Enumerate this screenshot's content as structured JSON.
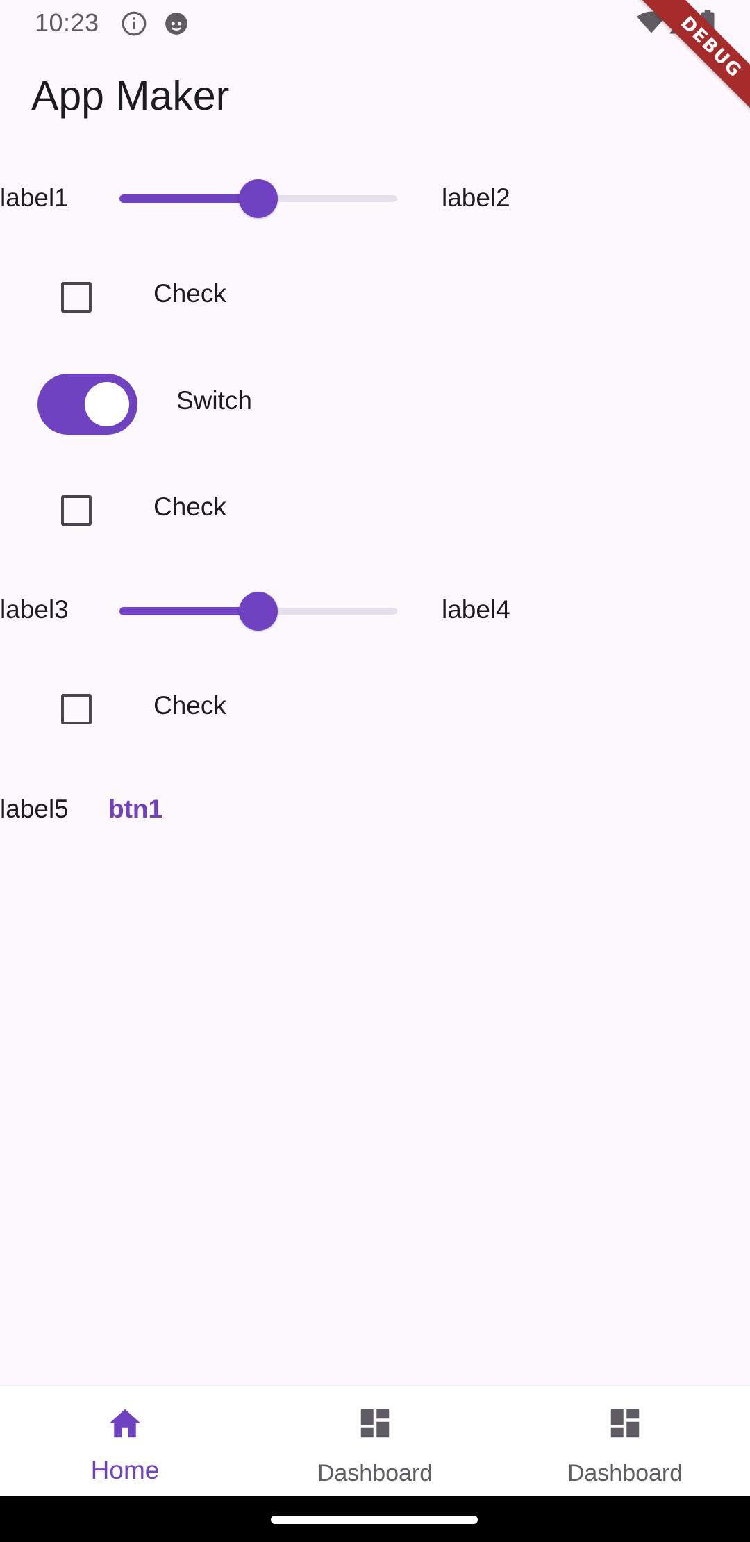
{
  "status_bar": {
    "time": "10:23"
  },
  "debug_banner": "DEBUG",
  "app_bar": {
    "title": "App Maker"
  },
  "rows": {
    "slider1": {
      "left_label": "label1",
      "right_label": "label2",
      "value": 0.5
    },
    "check1": {
      "label": "Check",
      "checked": false
    },
    "switch1": {
      "label": "Switch",
      "on": true
    },
    "check2": {
      "label": "Check",
      "checked": false
    },
    "slider2": {
      "left_label": "label3",
      "right_label": "label4",
      "value": 0.5
    },
    "check3": {
      "label": "Check",
      "checked": false
    },
    "button_row": {
      "label": "label5",
      "button": "btn1"
    }
  },
  "bottom_nav": {
    "items": [
      {
        "label": "Home",
        "icon": "home-icon",
        "active": true
      },
      {
        "label": "Dashboard",
        "icon": "dashboard-icon",
        "active": false
      },
      {
        "label": "Dashboard",
        "icon": "dashboard-icon",
        "active": false
      }
    ]
  },
  "colors": {
    "accent": "#6f42c1",
    "background": "#fdf8fd",
    "inactive_track": "#e7e0ec",
    "debug_ribbon": "#a62b2b"
  }
}
